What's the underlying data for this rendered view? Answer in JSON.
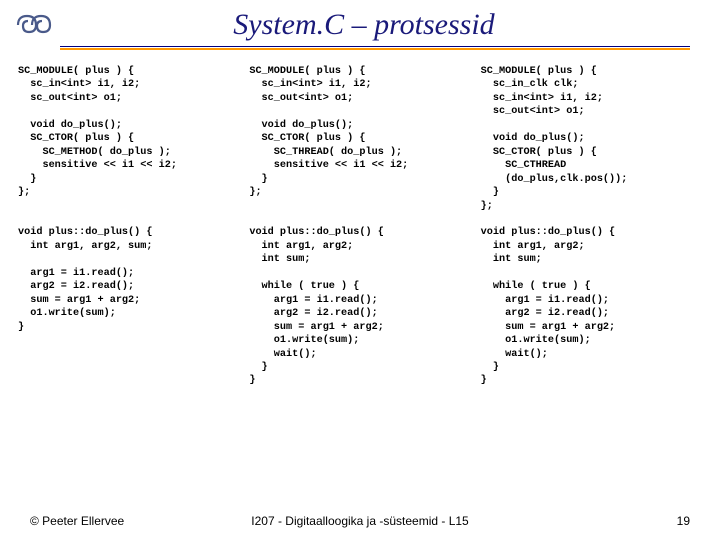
{
  "header": {
    "title": "System.C – protsessid"
  },
  "columns": {
    "col1": "SC_MODULE( plus ) {\n  sc_in<int> i1, i2;\n  sc_out<int> o1;\n\n  void do_plus();\n  SC_CTOR( plus ) {\n    SC_METHOD( do_plus );\n    sensitive << i1 << i2;\n  }\n};\n\n\nvoid plus::do_plus() {\n  int arg1, arg2, sum;\n\n  arg1 = i1.read();\n  arg2 = i2.read();\n  sum = arg1 + arg2;\n  o1.write(sum);\n}",
    "col2": "SC_MODULE( plus ) {\n  sc_in<int> i1, i2;\n  sc_out<int> o1;\n\n  void do_plus();\n  SC_CTOR( plus ) {\n    SC_THREAD( do_plus );\n    sensitive << i1 << i2;\n  }\n};\n\n\nvoid plus::do_plus() {\n  int arg1, arg2;\n  int sum;\n\n  while ( true ) {\n    arg1 = i1.read();\n    arg2 = i2.read();\n    sum = arg1 + arg2;\n    o1.write(sum);\n    wait();\n  }\n}",
    "col3": "SC_MODULE( plus ) {\n  sc_in_clk clk;\n  sc_in<int> i1, i2;\n  sc_out<int> o1;\n\n  void do_plus();\n  SC_CTOR( plus ) {\n    SC_CTHREAD\n    (do_plus,clk.pos());\n  }\n};\n\nvoid plus::do_plus() {\n  int arg1, arg2;\n  int sum;\n\n  while ( true ) {\n    arg1 = i1.read();\n    arg2 = i2.read();\n    sum = arg1 + arg2;\n    o1.write(sum);\n    wait();\n  }\n}"
  },
  "footer": {
    "left": "© Peeter Ellervee",
    "center": "I207 - Digitaalloogika ja -süsteemid - L15",
    "right": "19"
  }
}
